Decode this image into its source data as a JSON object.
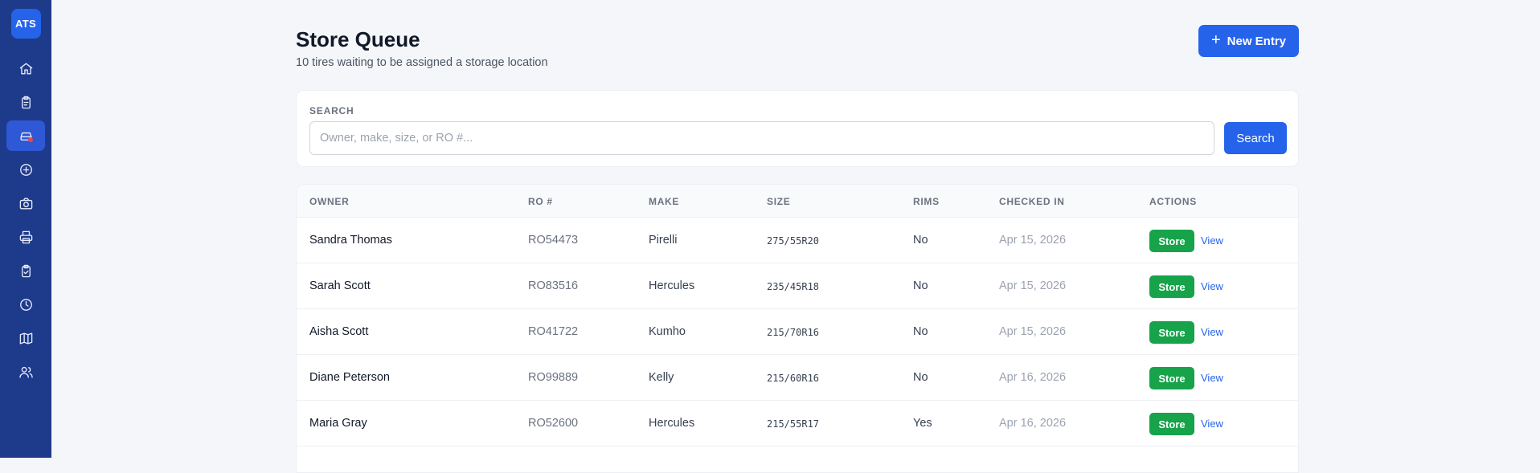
{
  "sidebar": {
    "logo": "ATS",
    "items": [
      {
        "icon": "home-icon"
      },
      {
        "icon": "clipboard-icon"
      },
      {
        "icon": "tire-storage-icon",
        "active": true
      },
      {
        "icon": "plus-circle-icon"
      },
      {
        "icon": "camera-icon"
      },
      {
        "icon": "printer-icon"
      },
      {
        "icon": "clipboard-check-icon"
      },
      {
        "icon": "clock-icon"
      },
      {
        "icon": "map-icon"
      },
      {
        "icon": "users-icon"
      }
    ]
  },
  "header": {
    "title": "Store Queue",
    "subtitle": "10 tires waiting to be assigned a storage location",
    "new_entry_label": "New Entry"
  },
  "search": {
    "label": "SEARCH",
    "placeholder": "Owner, make, size, or RO #...",
    "value": "",
    "button_label": "Search"
  },
  "table": {
    "columns": [
      "OWNER",
      "RO #",
      "MAKE",
      "SIZE",
      "RIMS",
      "CHECKED IN",
      "ACTIONS"
    ],
    "rows": [
      {
        "owner": "Sandra Thomas",
        "ro": "RO54473",
        "make": "Pirelli",
        "size": "275/55R20",
        "rims": "No",
        "checked_in": "Apr 15, 2026",
        "store": "Store",
        "view": "View"
      },
      {
        "owner": "Sarah Scott",
        "ro": "RO83516",
        "make": "Hercules",
        "size": "235/45R18",
        "rims": "No",
        "checked_in": "Apr 15, 2026",
        "store": "Store",
        "view": "View"
      },
      {
        "owner": "Aisha Scott",
        "ro": "RO41722",
        "make": "Kumho",
        "size": "215/70R16",
        "rims": "No",
        "checked_in": "Apr 15, 2026",
        "store": "Store",
        "view": "View"
      },
      {
        "owner": "Diane Peterson",
        "ro": "RO99889",
        "make": "Kelly",
        "size": "215/60R16",
        "rims": "No",
        "checked_in": "Apr 16, 2026",
        "store": "Store",
        "view": "View"
      },
      {
        "owner": "Maria Gray",
        "ro": "RO52600",
        "make": "Hercules",
        "size": "215/55R17",
        "rims": "Yes",
        "checked_in": "Apr 16, 2026",
        "store": "Store",
        "view": "View"
      }
    ]
  },
  "colors": {
    "sidebar": "#1e3a8a",
    "primary": "#2563eb",
    "store": "#16a34a"
  }
}
